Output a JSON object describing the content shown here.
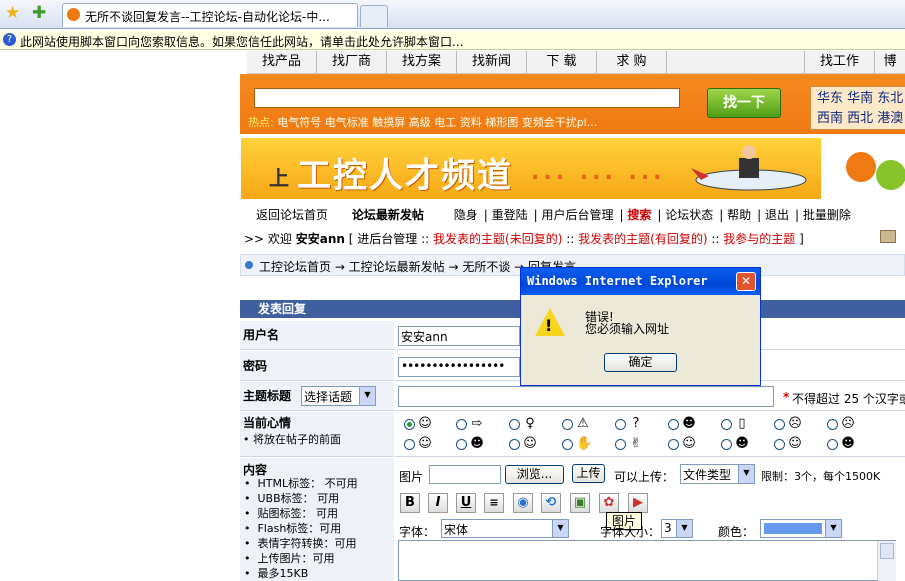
{
  "browser": {
    "tab_title": "无所不谈回复发言--工控论坛-自动化论坛-中...",
    "info_bar": "此网站使用脚本窗口向您索取信息。如果您信任此网站，请单击此处允许脚本窗口..."
  },
  "top_nav": [
    "找产品",
    "找厂商",
    "找方案",
    "找新闻",
    "下 载",
    "求 购",
    "",
    "找工作",
    "博"
  ],
  "search": {
    "hot_label": "热点:",
    "hot_links": "电气符号  电气标准  触摸屏  高级  电工  资料  梯形图  变频会干扰pl...",
    "button": "找一下",
    "regions_row1": "华东  华南  东北",
    "regions_row2": "西南  西北  港澳"
  },
  "banner": {
    "small": "上",
    "title": "工控人才频道",
    "dots": "... ... ..."
  },
  "forum_links": [
    "返回论坛首页",
    "论坛最新发帖",
    "隐身",
    "重登陆",
    "用户后台管理",
    "搜索",
    "论坛状态",
    "帮助",
    "退出",
    "批量删除"
  ],
  "welcome": {
    "prefix": ">> 欢迎",
    "user": "安安ann",
    "admin": "[ 进后台管理 ::",
    "link1": "我发表的主题(未回复的)",
    "sep1": "::",
    "link2": "我发表的主题(有回复的)",
    "sep2": "::",
    "link3": "我参与的主题",
    "suffix": "]"
  },
  "breadcrumb": "工控论坛首页 → 工控论坛最新发帖 → 无所不谈 → 回复发言",
  "form": {
    "header": "发表回复",
    "username_label": "用户名",
    "username_value": "安安ann",
    "password_label": "密码",
    "password_value": "•••••••••••••••••",
    "subject_label": "主题标题",
    "subject_select": "选择话题",
    "subject_hint_star": "*",
    "subject_hint": "不得超过 25 个汉字或",
    "mood_label": "当前心情",
    "mood_note": "将放在帖子的前面",
    "content_label": "内容",
    "content_rules": [
      "HTML标签： 不可用",
      "UBB标签： 可用",
      "贴图标签： 可用",
      "Flash标签：可用",
      "表情字符转换：可用",
      "上传图片：可用",
      "最多15KB"
    ],
    "upload_label": "图片",
    "browse_button": "浏览...",
    "upload_button": "上传",
    "can_upload": "可以上传：",
    "file_type": "文件类型",
    "limit": "限制：3个，每个1500K",
    "font_label": "字体：",
    "font_value": "宋体",
    "size_label": "字体大小：",
    "size_value": "3",
    "color_label": "颜色："
  },
  "tooltip": "图片",
  "dialog": {
    "title": "Windows Internet Explorer",
    "line1": "错误!",
    "line2": "您必须输入网址",
    "ok": "确定"
  },
  "colors": {
    "accent_orange": "#f07a12",
    "xp_blue": "#0a5ff0",
    "form_header": "#3f5f9e"
  }
}
